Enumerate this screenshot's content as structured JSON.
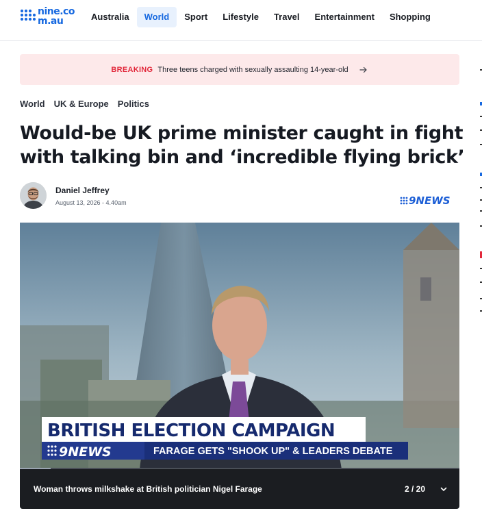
{
  "header": {
    "logo_text": "nine.com.au",
    "nav": [
      {
        "label": "Australia",
        "active": false
      },
      {
        "label": "World",
        "active": true
      },
      {
        "label": "Sport",
        "active": false
      },
      {
        "label": "Lifestyle",
        "active": false
      },
      {
        "label": "Travel",
        "active": false
      },
      {
        "label": "Entertainment",
        "active": false
      },
      {
        "label": "Shopping",
        "active": false
      }
    ]
  },
  "breaking": {
    "label": "BREAKING",
    "text": "Three teens charged with sexually assaulting 14-year-old",
    "icon": "arrow-right-icon"
  },
  "breadcrumb": [
    "World",
    "UK & Europe",
    "Politics"
  ],
  "article": {
    "headline": "Would-be UK prime minister caught in fight with talking bin and ‘incredible flying brick’",
    "author": "Daniel Jeffrey",
    "date": "August 13, 2026 - 4.40am",
    "brand": "9NEWS"
  },
  "video": {
    "lower_third_title": "BRITISH ELECTION CAMPAIGN",
    "lower_third_brand": "9NEWS",
    "lower_third_subtitle": "FARAGE GETS \"SHOOK UP\" & LEADERS DEBATE",
    "progress": 0.07
  },
  "gallery": {
    "caption": "Woman throws milkshake at British politician Nigel Farage",
    "counter": "2 / 20",
    "expand_icon": "chevron-down-icon"
  },
  "colors": {
    "accent": "#1769e0",
    "breaking_red": "#e2283b",
    "breaking_bg": "#fde9ea",
    "caption_bg": "#1b1d21"
  }
}
